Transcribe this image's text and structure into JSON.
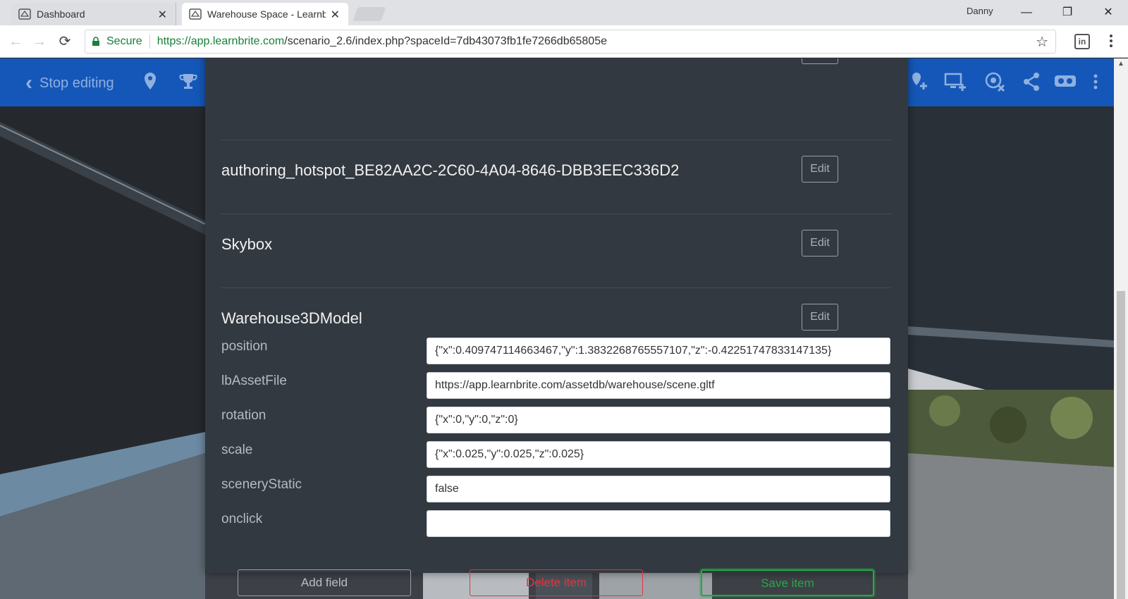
{
  "browser": {
    "tabs": [
      {
        "title": "Dashboard",
        "active": false
      },
      {
        "title": "Warehouse Space - Learnbrite",
        "active": true
      }
    ],
    "user": "Danny",
    "secure_label": "Secure",
    "url_host": "https://app.learnbrite.com",
    "url_path": "/scenario_2.6/index.php?spaceId=7db43073fb1fe7266db65805e",
    "extension_label": "in"
  },
  "appbar": {
    "stop_editing": "Stop editing",
    "color": "#1557b8"
  },
  "items": [
    {
      "name": "authoring_hotspot_BE82AA2C-2C60-4A04-8646-DBB3EEC336D2",
      "edit": "Edit"
    },
    {
      "name": "Skybox",
      "edit": "Edit"
    },
    {
      "name": "Warehouse3DModel",
      "edit": "Edit"
    }
  ],
  "fields": [
    {
      "label": "position",
      "value": "{\"x\":0.409747114663467,\"y\":1.3832268765557107,\"z\":-0.42251747833147135}"
    },
    {
      "label": "lbAssetFile",
      "value": "https://app.learnbrite.com/assetdb/warehouse/scene.gltf"
    },
    {
      "label": "rotation",
      "value": "{\"x\":0,\"y\":0,\"z\":0}"
    },
    {
      "label": "scale",
      "value": "{\"x\":0.025,\"y\":0.025,\"z\":0.025}"
    },
    {
      "label": "sceneryStatic",
      "value": "false"
    },
    {
      "label": "onclick",
      "value": ""
    }
  ],
  "buttons": {
    "add_field": "Add field",
    "delete_item": "Delete item",
    "save_item": "Save item"
  },
  "colors": {
    "danger": "#e0363f",
    "success": "#28a745",
    "modal_bg": "#333941"
  }
}
